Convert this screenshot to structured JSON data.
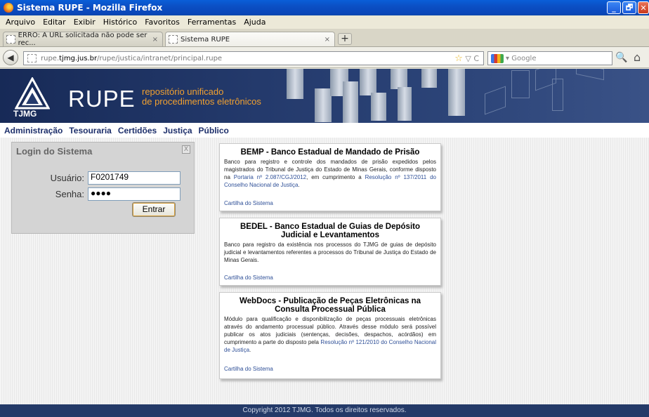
{
  "window": {
    "title": "Sistema RUPE - Mozilla Firefox",
    "minimize_glyph": "_",
    "maximize_glyph": "🗗",
    "close_glyph": "✕"
  },
  "menu": [
    "Arquivo",
    "Editar",
    "Exibir",
    "Histórico",
    "Favoritos",
    "Ferramentas",
    "Ajuda"
  ],
  "tabs": [
    {
      "label": "ERRO: A URL solicitada não pode ser rec...",
      "close": "×"
    },
    {
      "label": "Sistema RUPE",
      "close": "×"
    }
  ],
  "new_tab_glyph": "+",
  "navbar": {
    "back_glyph": "◀",
    "url_prefix": "rupe.",
    "url_host": "tjmg.jus.br",
    "url_path": "/rupe/justica/intranet/principal.rupe",
    "url_actions": "▽ C",
    "star_glyph": "☆",
    "search_placeholder": "Google",
    "search_dropdown": "▾",
    "search_glyph": "🔍",
    "home_glyph": "⌂"
  },
  "banner": {
    "logo_text": "TJMG",
    "app_name": "RUPE",
    "tagline_line1": "repositório unificado",
    "tagline_line2": "de procedimentos eletrônicos"
  },
  "topnav": [
    "Administração",
    "Tesouraria",
    "Certidões",
    "Justiça",
    "Público"
  ],
  "login": {
    "title": "Login do Sistema",
    "close_glyph": "X",
    "user_label": "Usuário:",
    "user_value": "F0201749",
    "password_label": "Senha:",
    "password_value": "●●●●",
    "submit": "Entrar"
  },
  "cards": [
    {
      "title": "BEMP - Banco Estadual de Mandado de Prisão",
      "text1": "Banco para registro e controle dos mandados de prisão expedidos pelos magistrados do Tribunal de Justiça do Estado de Minas Gerais, conforme disposto na ",
      "link1": "Portaria nº 2.087/CGJ/2012",
      "text2": ", em cumprimento a ",
      "link2": "Resolução nº 137/2011 do Conselho Nacional de Justiça",
      "text3": ".",
      "cartilha": "Cartilha do Sistema"
    },
    {
      "title": "BEDEL - Banco Estadual de Guias de Depósito Judicial e Levantamentos",
      "text1": "Banco para registro da existência nos processos do TJMG de guias de depósito judicial e levantamentos referentes a processos do Tribunal de Justiça do Estado de Minas Gerais.",
      "cartilha": "Cartilha do Sistema"
    },
    {
      "title": "WebDocs - Publicação de Peças Eletrônicas na Consulta Processual Pública",
      "text1": "Módulo para qualificação e disponibilização de peças processuais eletrônicas através do andamento processual público. Através desse módulo será possível publicar os atos judiciais (sentenças, decisões, despachos, acórdãos) em cumprimento a parte do disposto pela ",
      "link1": "Resolução nº 121/2010 do Conselho Nacional de Justiça",
      "text2": ".",
      "cartilha": "Cartilha do Sistema"
    }
  ],
  "footer": "Copyright 2012 TJMG. Todos os direitos reservados."
}
